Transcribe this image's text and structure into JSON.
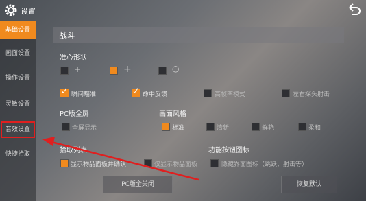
{
  "header": {
    "title": "设置"
  },
  "sidebar": {
    "items": [
      {
        "label": "基础设置"
      },
      {
        "label": "画面设置"
      },
      {
        "label": "操作设置"
      },
      {
        "label": "灵敏设置"
      },
      {
        "label": "音效设置"
      },
      {
        "label": "快捷拾取"
      }
    ]
  },
  "main": {
    "section_title": "战斗",
    "crosshair": {
      "label": "准心形状"
    },
    "options_row": [
      {
        "label": "瞬间瞄准",
        "checked": true
      },
      {
        "label": "命中反馈",
        "checked": true
      },
      {
        "label": "高帧率模式",
        "checked": false
      },
      {
        "label": "左右探头射击",
        "checked": false
      }
    ],
    "pc_fullscreen": {
      "label": "PC版全屏",
      "option": "全屏显示"
    },
    "style": {
      "label": "画面风格",
      "options": [
        {
          "label": "标准",
          "selected": true
        },
        {
          "label": "清新",
          "selected": false
        },
        {
          "label": "鲜艳",
          "selected": false
        },
        {
          "label": "柔和",
          "selected": false
        }
      ]
    },
    "pickup": {
      "label": "拾取列表",
      "options": [
        {
          "label": "显示物品面板并确认",
          "checked": true
        },
        {
          "label": "仅显示物品面板",
          "checked": false
        }
      ]
    },
    "func_icons": {
      "label": "功能按钮图标",
      "option": "隐藏界面图标（跳跃、射击等）"
    },
    "buttons": {
      "left": "PC版全关闭",
      "right": "恢复默认"
    }
  },
  "colors": {
    "accent": "#f08a1e",
    "highlight": "#e01f1f"
  }
}
